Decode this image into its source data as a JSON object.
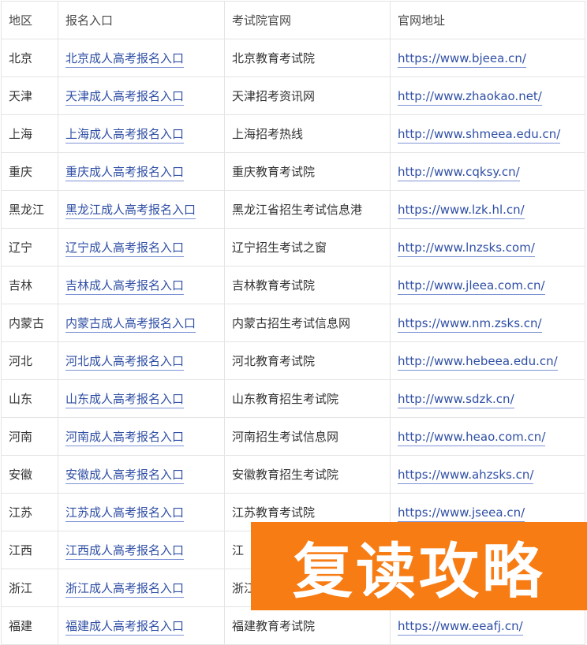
{
  "table": {
    "headers": [
      "地区",
      "报名入口",
      "考试院官网",
      "官网地址"
    ],
    "rows": [
      {
        "region": "北京",
        "entry": "北京成人高考报名入口",
        "office": "北京教育考试院",
        "url": "https://www.bjeea.cn/"
      },
      {
        "region": "天津",
        "entry": "天津成人高考报名入口",
        "office": "天津招考资讯网",
        "url": "http://www.zhaokao.net/"
      },
      {
        "region": "上海",
        "entry": "上海成人高考报名入口",
        "office": "上海招考热线",
        "url": "http://www.shmeea.edu.cn/"
      },
      {
        "region": "重庆",
        "entry": "重庆成人高考报名入口",
        "office": "重庆教育考试院",
        "url": "http://www.cqksy.cn/"
      },
      {
        "region": "黑龙江",
        "entry": "黑龙江成人高考报名入口",
        "office": "黑龙江省招生考试信息港",
        "url": "https://www.lzk.hl.cn/"
      },
      {
        "region": "辽宁",
        "entry": "辽宁成人高考报名入口",
        "office": "辽宁招生考试之窗",
        "url": "http://www.lnzsks.com/"
      },
      {
        "region": "吉林",
        "entry": "吉林成人高考报名入口",
        "office": "吉林教育考试院",
        "url": "http://www.jleea.com.cn/"
      },
      {
        "region": "内蒙古",
        "entry": "内蒙古成人高考报名入口",
        "office": "内蒙古招生考试信息网",
        "url": "https://www.nm.zsks.cn/"
      },
      {
        "region": "河北",
        "entry": "河北成人高考报名入口",
        "office": "河北教育考试院",
        "url": "http://www.hebeea.edu.cn/"
      },
      {
        "region": "山东",
        "entry": "山东成人高考报名入口",
        "office": "山东教育招生考试院",
        "url": "http://www.sdzk.cn/"
      },
      {
        "region": "河南",
        "entry": "河南成人高考报名入口",
        "office": "河南招生考试信息网",
        "url": "http://www.heao.com.cn/"
      },
      {
        "region": "安徽",
        "entry": "安徽成人高考报名入口",
        "office": "安徽教育招生考试院",
        "url": "https://www.ahzsks.cn/"
      },
      {
        "region": "江苏",
        "entry": "江苏成人高考报名入口",
        "office": "江苏教育考试院",
        "url": "https://www.jseea.cn/"
      },
      {
        "region": "江西",
        "entry": "江西成人高考报名入口",
        "office": "江",
        "url": ""
      },
      {
        "region": "浙江",
        "entry": "浙江成人高考报名入口",
        "office": "浙江",
        "url": ""
      },
      {
        "region": "福建",
        "entry": "福建成人高考报名入口",
        "office": "福建教育考试院",
        "url": "https://www.eeafj.cn/"
      }
    ]
  },
  "banner": {
    "text": "复读攻略"
  },
  "colors": {
    "link": "#2f4fa5",
    "link_underline": "#7e93d6",
    "border": "#e4e4e4",
    "banner_bg": "#f77c14"
  }
}
